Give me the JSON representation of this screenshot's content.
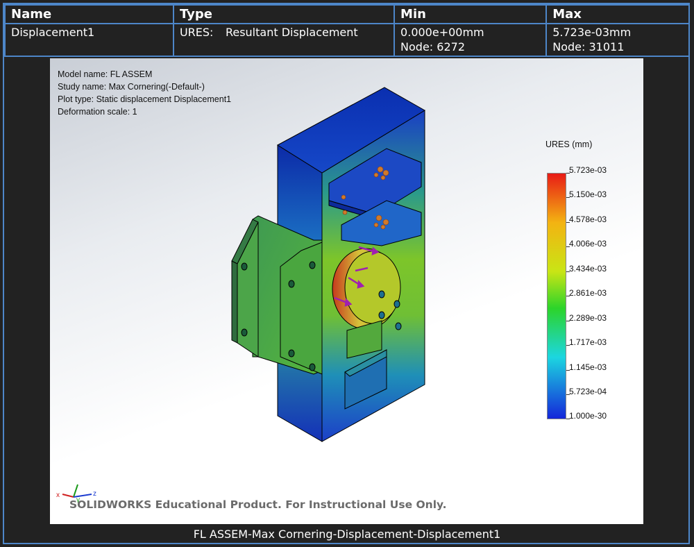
{
  "table": {
    "headers": [
      "Name",
      "Type",
      "Min",
      "Max"
    ],
    "row": {
      "name": "Displacement1",
      "type_code": "URES:",
      "type_label": "Resultant Displacement",
      "min_value": "0.000e+00mm",
      "min_node": "Node: 6272",
      "max_value": "5.723e-03mm",
      "max_node": "Node: 31011"
    }
  },
  "plot_info": {
    "model_name": "Model name: FL ASSEM",
    "study_name": "Study name: Max Cornering(-Default-)",
    "plot_type": "Plot type: Static displacement Displacement1",
    "deformation_scale": "Deformation scale: 1"
  },
  "legend": {
    "title": "URES (mm)",
    "ticks": [
      "5.723e-03",
      "5.150e-03",
      "4.578e-03",
      "4.006e-03",
      "3.434e-03",
      "2.861e-03",
      "2.289e-03",
      "1.717e-03",
      "1.145e-03",
      "5.723e-04",
      "1.000e-30"
    ]
  },
  "triad": {
    "x": "x",
    "y": "y",
    "z": "z"
  },
  "watermark": "SOLIDWORKS Educational Product. For Instructional Use Only.",
  "caption": "FL ASSEM-Max Cornering-Displacement-Displacement1",
  "colors": {
    "border": "#4d86c9",
    "background": "#222222",
    "max": "#e81b16",
    "min": "#1426d9"
  }
}
